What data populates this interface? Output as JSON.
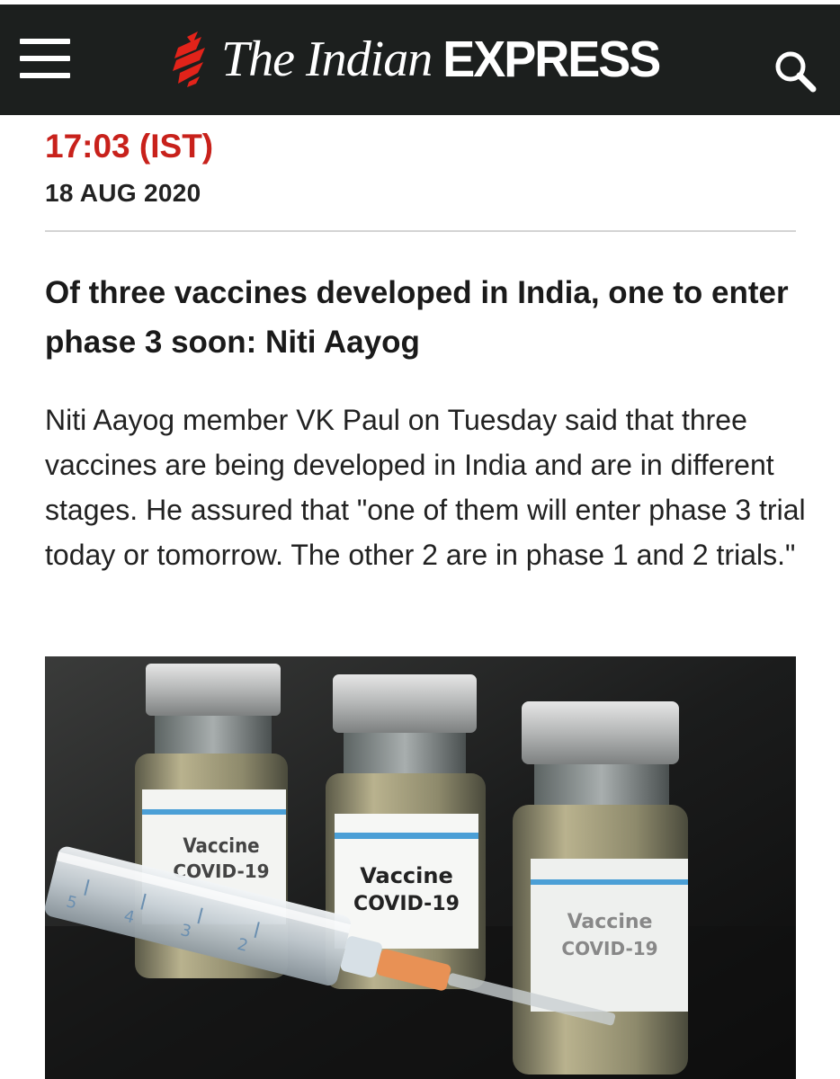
{
  "header": {
    "menu_icon": "hamburger-menu-icon",
    "logo_text_italic": "The Indian",
    "logo_text_bold": "EXPRESS",
    "search_icon": "search-icon",
    "background": "#1c1f1e",
    "logo_mark_color": "#e2231a"
  },
  "update": {
    "time": "17:03 (IST)",
    "date": "18 AUG 2020",
    "time_color": "#c8211b"
  },
  "article": {
    "headline": "Of three vaccines developed in India, one to enter phase 3 soon: Niti Aayog",
    "body": "Niti Aayog member VK Paul on Tuesday said that three vaccines are being developed in India and are in different stages. He assured that \"one of them will enter phase 3 trial today or tomorrow. The other 2 are in phase 1 and 2 trials.\""
  },
  "photo": {
    "vial_labels": [
      {
        "line1": "Vaccine",
        "line2": "COVID-19"
      },
      {
        "line1": "Vaccine",
        "line2": "COVID-19"
      },
      {
        "line1": "Vaccine",
        "line2": "COVID-19"
      }
    ],
    "syringe_marks": [
      "5",
      "4",
      "3",
      "2"
    ]
  }
}
